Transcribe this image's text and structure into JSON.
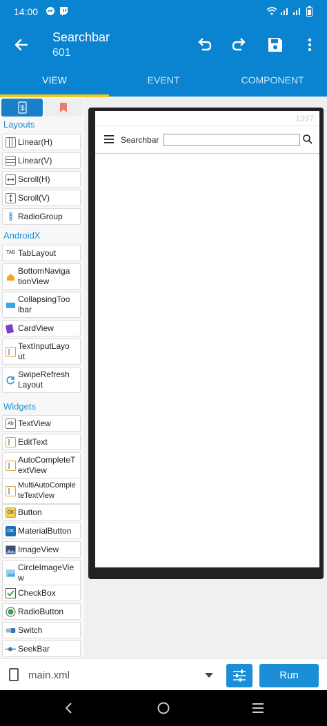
{
  "status_bar": {
    "time": "14:00"
  },
  "app_bar": {
    "title": "Searchbar",
    "subtitle": "601"
  },
  "tabs": [
    {
      "label": "VIEW",
      "active": true
    },
    {
      "label": "EVENT",
      "active": false
    },
    {
      "label": "COMPONENT",
      "active": false
    }
  ],
  "palette": {
    "sections": {
      "layouts": "Layouts",
      "androidx": "AndroidX",
      "widgets": "Widgets"
    },
    "layouts": [
      "Linear(H)",
      "Linear(V)",
      "Scroll(H)",
      "Scroll(V)",
      "RadioGroup"
    ],
    "androidx": [
      "TabLayout",
      "BottomNavigationView",
      "CollapsingToolbar",
      "CardView",
      "TextInputLayout",
      "SwipeRefreshLayout"
    ],
    "androidx_display": [
      "TabLayout",
      "BottomNaviga\ntionView",
      "CollapsingToo\nlbar",
      "CardView",
      "TextInputLayo\nut",
      "SwipeRefresh\nLayout"
    ],
    "widgets": [
      "TextView",
      "EditText",
      "AutoCompleteTextView",
      "MultiAutoCompleteTextView",
      "Button",
      "MaterialButton",
      "ImageView",
      "CircleImageView",
      "CheckBox",
      "RadioButton",
      "Switch",
      "SeekBar"
    ],
    "widgets_display": [
      "TextView",
      "EditText",
      "AutoCompleteT\nextView",
      "MultiAutoComple\nteTextView",
      "Button",
      "MaterialButton",
      "ImageView",
      "CircleImageVie\nw",
      "CheckBox",
      "RadioButton",
      "Switch",
      "SeekBar"
    ],
    "icon_labels": {
      "tab": "TAB",
      "ab": "Ab",
      "ok": "OK"
    }
  },
  "preview": {
    "status_number": "1397",
    "searchbar_title": "Searchbar",
    "search_value": ""
  },
  "bottom_bar": {
    "file_name": "main.xml",
    "run_label": "Run"
  },
  "colors": {
    "primary": "#0a84d0",
    "accent": "#f5c518",
    "button": "#1a8fd8"
  }
}
